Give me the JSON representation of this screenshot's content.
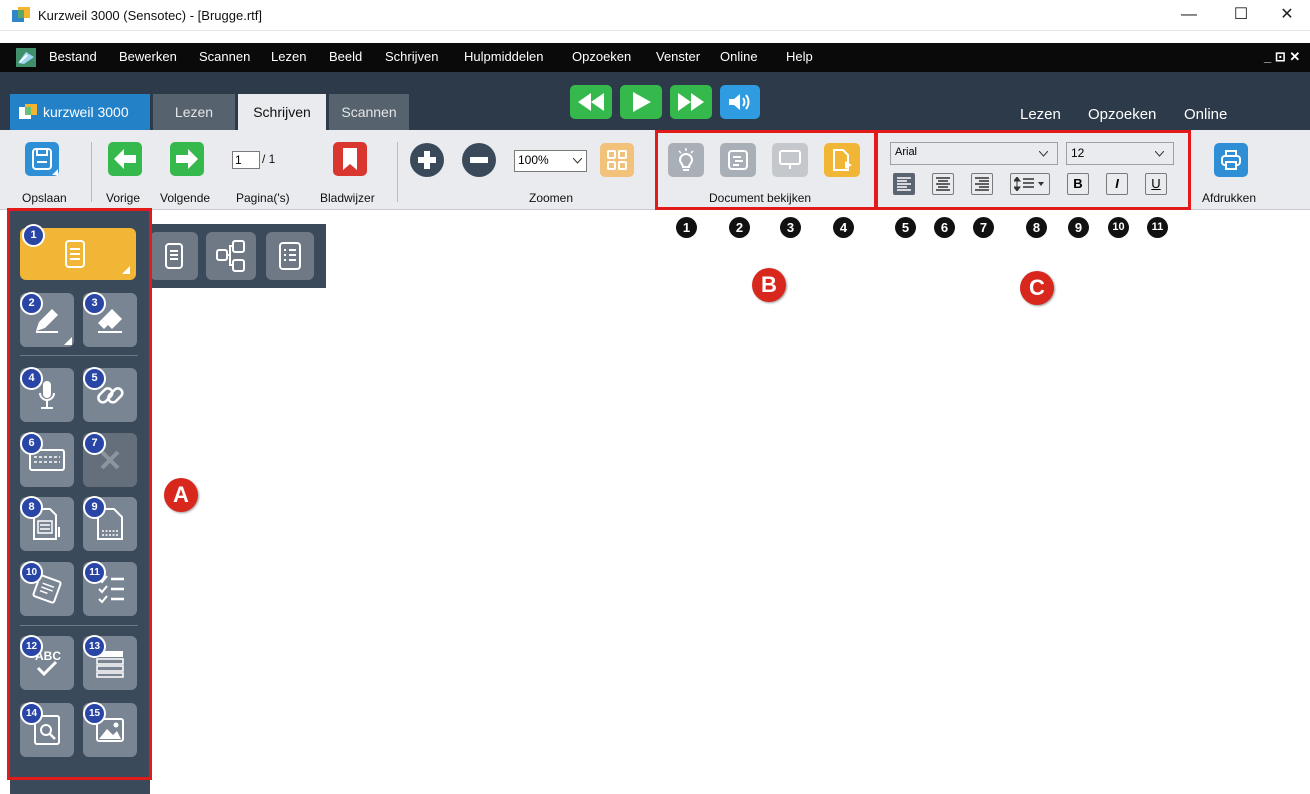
{
  "window": {
    "title": "Kurzweil 3000 (Sensotec) - [Brugge.rtf]",
    "minimize_glyph": "—",
    "maximize_glyph": "☐",
    "close_glyph": "✕"
  },
  "menu": {
    "items": [
      "Bestand",
      "Bewerken",
      "Scannen",
      "Lezen",
      "Beeld",
      "Schrijven",
      "Hulpmiddelen",
      "Opzoeken",
      "Venster",
      "Online",
      "Help"
    ],
    "mdi_controls": "_ ⊡ ✕"
  },
  "tabs": {
    "logo": "kurzweil 3000",
    "items": [
      "Lezen",
      "Schrijven",
      "Scannen"
    ],
    "active": "Schrijven",
    "right_links": [
      "Lezen",
      "Opzoeken",
      "Online"
    ]
  },
  "toolbar": {
    "save": "Opslaan",
    "prev": "Vorige",
    "next": "Volgende",
    "page_value": "1",
    "page_total": "/ 1",
    "pages_label": "Pagina('s)",
    "bookmark": "Bladwijzer",
    "zoom_value": "100%",
    "zoom_label": "Zoomen",
    "document_view_label": "Document bekijken",
    "font_name": "Arial",
    "font_size": "12",
    "bold": "B",
    "italic": "I",
    "underline": "U",
    "print": "Afdrukken"
  },
  "annotations": {
    "b_numbers": [
      "1",
      "2",
      "3",
      "4"
    ],
    "c_numbers": [
      "5",
      "6",
      "7",
      "8",
      "9",
      "10",
      "11"
    ],
    "letters": [
      "A",
      "B",
      "C"
    ],
    "sidebar_badges": [
      "1",
      "2",
      "3",
      "4",
      "5",
      "6",
      "7",
      "8",
      "9",
      "10",
      "11",
      "12",
      "13",
      "14",
      "15"
    ]
  },
  "colors": {
    "menubar": "#0a0a0a",
    "tabstrip": "#2d3a49",
    "sidebar": "#3b4a5a",
    "accent_green": "#35b94c",
    "accent_blue": "#2f8fd6",
    "accent_orange": "#f2b636",
    "accent_red": "#d8362e",
    "annotation_red": "#e21a1a"
  }
}
